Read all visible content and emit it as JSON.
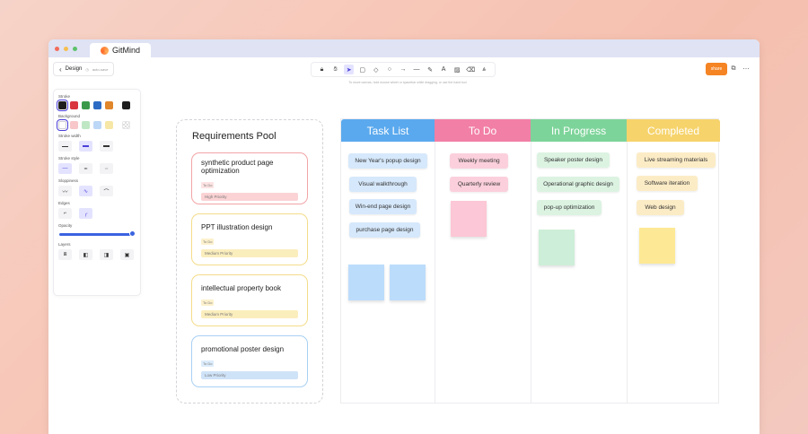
{
  "app": {
    "name": "GitMind",
    "window_dots": [
      "#f26b5a",
      "#f6bf4f",
      "#5cc26a"
    ]
  },
  "breadcrumb": {
    "title": "Design",
    "status": "auto-save"
  },
  "toolbar": {
    "tools": [
      {
        "name": "lock-icon",
        "glyph": "🔒︎"
      },
      {
        "name": "hand-icon",
        "glyph": "✋︎"
      },
      {
        "name": "select-icon",
        "glyph": "➤"
      },
      {
        "name": "rectangle-icon",
        "glyph": "▢"
      },
      {
        "name": "diamond-icon",
        "glyph": "◇"
      },
      {
        "name": "circle-icon",
        "glyph": "○"
      },
      {
        "name": "arrow-icon",
        "glyph": "→"
      },
      {
        "name": "line-icon",
        "glyph": "—"
      },
      {
        "name": "pen-icon",
        "glyph": "✎"
      },
      {
        "name": "text-icon",
        "glyph": "A"
      },
      {
        "name": "image-icon",
        "glyph": "▨"
      },
      {
        "name": "eraser-icon",
        "glyph": "⌫"
      },
      {
        "name": "more-tools-icon",
        "glyph": "⩓"
      }
    ],
    "active_index": 2,
    "hint": "To move canvas, hold mouse wheel or spacebar while dragging, or use the hand tool"
  },
  "share": {
    "label": "share"
  },
  "panel": {
    "stroke_label": "Stroke",
    "stroke_colors": [
      "#1e1e1e",
      "#d9363e",
      "#3a9a4a",
      "#2c6bc4",
      "#e0862b",
      "#1e1e1e"
    ],
    "background_label": "Background",
    "background_colors": [
      "#ffffff",
      "#f7c7c9",
      "#bfe7c4",
      "#bdd7f7",
      "#f7e7a6",
      "transparent"
    ],
    "stroke_width_label": "Stroke width",
    "stroke_style_label": "Stroke style",
    "sloppiness_label": "Sloppiness",
    "edges_label": "Edges",
    "opacity_label": "Opacity",
    "opacity_value": 1.0,
    "layers_label": "Layers"
  },
  "pool": {
    "title": "Requirements Pool",
    "cards": [
      {
        "title": "synthetic product page optimization",
        "status": "To Do",
        "priority": "High Priority",
        "border": "#f2a4a6",
        "status_bg": "#fde3e3",
        "priority_bg": "#fbd3d5"
      },
      {
        "title": "PPT illustration design",
        "status": "To Do",
        "priority": "Medium Priority",
        "border": "#f4dc8a",
        "status_bg": "#fcf1cd",
        "priority_bg": "#fbeebd"
      },
      {
        "title": "intellectual property book",
        "status": "To Do",
        "priority": "Medium Priority",
        "border": "#f4dc8a",
        "status_bg": "#fcf1cd",
        "priority_bg": "#fbeebd"
      },
      {
        "title": "promotional poster design",
        "status": "To Do",
        "priority": "Low Priority",
        "border": "#a9d0f4",
        "status_bg": "#dcecfb",
        "priority_bg": "#cfe3f8"
      }
    ]
  },
  "board": {
    "columns": [
      {
        "title": "Task List",
        "color": "#5aa9ee",
        "tasks": [
          "New Year's popup design",
          "Visual walkthrough",
          "Win-end page design",
          "purchase page design"
        ],
        "task_bg": "#d6e8fb"
      },
      {
        "title": "To Do",
        "color": "#f27fa6",
        "tasks": [
          "Weekly meeting",
          "Quarterly review"
        ],
        "task_bg": "#fbd0dc"
      },
      {
        "title": "In Progress",
        "color": "#7dd49a",
        "tasks": [
          "Speaker poster design",
          "Operational graphic design",
          "pop-up optimization"
        ],
        "task_bg": "#dcf3e2"
      },
      {
        "title": "Completed",
        "color": "#f6d36b",
        "tasks": [
          "Live streaming materials",
          "Software iteration",
          "Web design"
        ],
        "task_bg": "#fcecc6"
      }
    ]
  }
}
